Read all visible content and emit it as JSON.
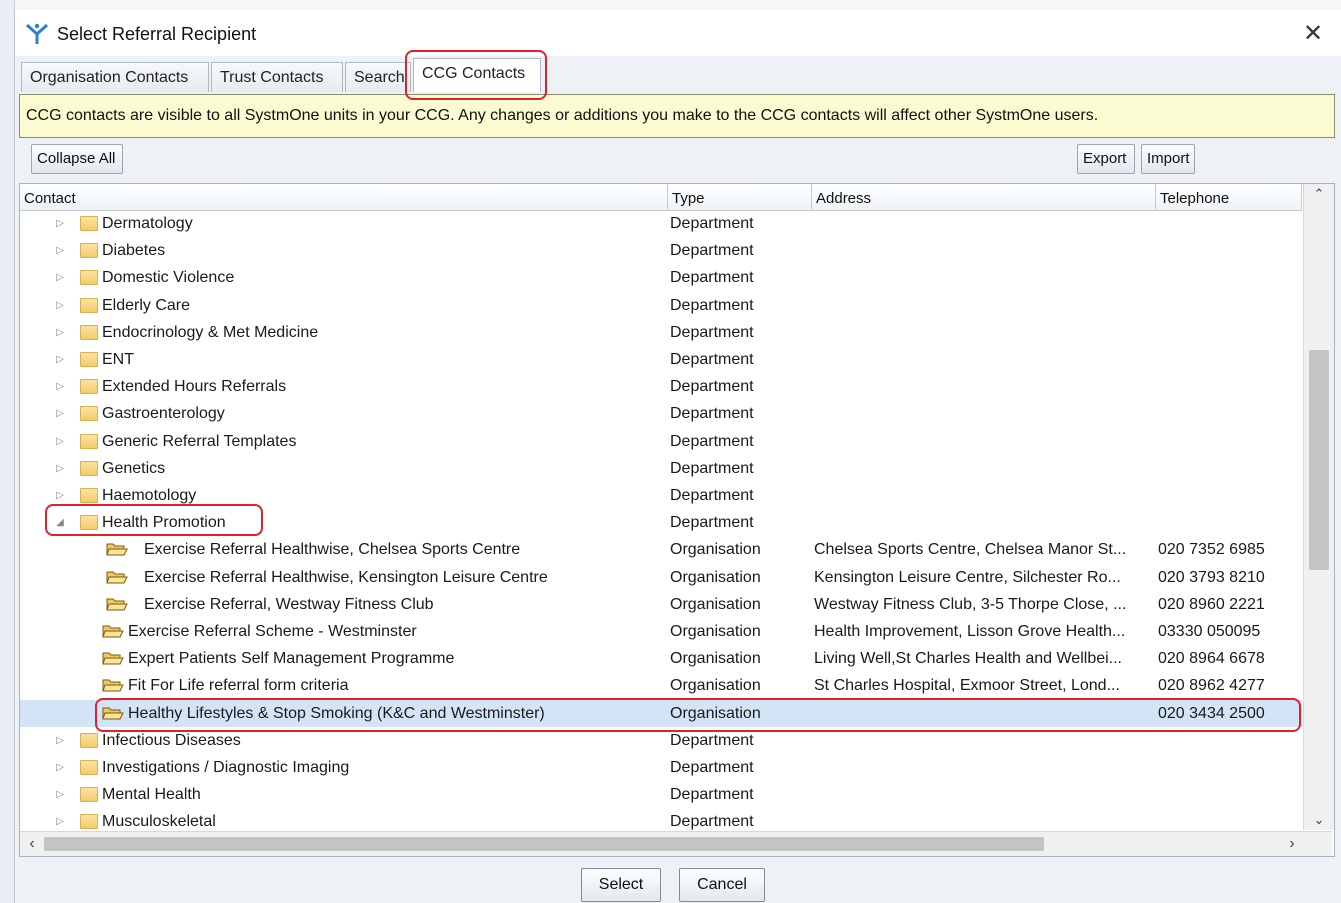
{
  "window": {
    "title": "Select Referral Recipient",
    "close_glyph": "✕"
  },
  "tabs": [
    {
      "label": "Organisation Contacts",
      "active": false
    },
    {
      "label": "Trust Contacts",
      "active": false
    },
    {
      "label": "Search",
      "active": false
    },
    {
      "label": "CCG Contacts",
      "active": true
    }
  ],
  "info_bar": {
    "text": "CCG contacts are visible to all SystmOne units in your CCG. Any changes or additions you make to the CCG contacts will affect other SystmOne users."
  },
  "toolbar": {
    "collapse_label": "Collapse All",
    "export_label": "Export",
    "import_label": "Import"
  },
  "table": {
    "columns": {
      "contact": "Contact",
      "type": "Type",
      "address": "Address",
      "telephone": "Telephone"
    },
    "rows": [
      {
        "contact": "Dermatology",
        "type": "Department",
        "address": "",
        "telephone": "",
        "level": 0,
        "expander": "▷"
      },
      {
        "contact": "Diabetes",
        "type": "Department",
        "address": "",
        "telephone": "",
        "level": 0,
        "expander": "▷"
      },
      {
        "contact": "Domestic Violence",
        "type": "Department",
        "address": "",
        "telephone": "",
        "level": 0,
        "expander": "▷"
      },
      {
        "contact": "Elderly Care",
        "type": "Department",
        "address": "",
        "telephone": "",
        "level": 0,
        "expander": "▷"
      },
      {
        "contact": "Endocrinology & Met Medicine",
        "type": "Department",
        "address": "",
        "telephone": "",
        "level": 0,
        "expander": "▷"
      },
      {
        "contact": "ENT",
        "type": "Department",
        "address": "",
        "telephone": "",
        "level": 0,
        "expander": "▷"
      },
      {
        "contact": "Extended Hours Referrals",
        "type": "Department",
        "address": "",
        "telephone": "",
        "level": 0,
        "expander": "▷"
      },
      {
        "contact": "Gastroenterology",
        "type": "Department",
        "address": "",
        "telephone": "",
        "level": 0,
        "expander": "▷"
      },
      {
        "contact": "Generic Referral Templates",
        "type": "Department",
        "address": "",
        "telephone": "",
        "level": 0,
        "expander": "▷"
      },
      {
        "contact": "Genetics",
        "type": "Department",
        "address": "",
        "telephone": "",
        "level": 0,
        "expander": "▷"
      },
      {
        "contact": "Haemotology",
        "type": "Department",
        "address": "",
        "telephone": "",
        "level": 0,
        "expander": "▷"
      },
      {
        "contact": "Health Promotion",
        "type": "Department",
        "address": "",
        "telephone": "",
        "level": 0,
        "expander": "◢"
      },
      {
        "contact": "Exercise Referral Healthwise, Chelsea Sports Centre",
        "type": "Organisation",
        "address": "Chelsea Sports Centre, Chelsea Manor St...",
        "telephone": "020 7352 6985",
        "level": 1,
        "expander": ""
      },
      {
        "contact": "Exercise Referral Healthwise, Kensington Leisure Centre",
        "type": "Organisation",
        "address": "Kensington Leisure Centre, Silchester Ro...",
        "telephone": "020 3793 8210",
        "level": 1,
        "expander": ""
      },
      {
        "contact": "Exercise Referral, Westway Fitness Club",
        "type": "Organisation",
        "address": "Westway Fitness Club, 3-5 Thorpe Close, ...",
        "telephone": "020 8960 2221",
        "level": 1,
        "expander": ""
      },
      {
        "contact": "Exercise Referral Scheme - Westminster",
        "type": "Organisation",
        "address": "Health Improvement, Lisson Grove Health...",
        "telephone": "03330 050095",
        "level": 1,
        "expander": ""
      },
      {
        "contact": "Expert Patients Self Management Programme",
        "type": "Organisation",
        "address": "Living Well,St Charles Health and Wellbei...",
        "telephone": "020 8964 6678",
        "level": 1,
        "expander": ""
      },
      {
        "contact": "Fit For Life referral form criteria",
        "type": "Organisation",
        "address": "St Charles Hospital, Exmoor Street, Lond...",
        "telephone": "020 8962 4277",
        "level": 1,
        "expander": ""
      },
      {
        "contact": "Healthy Lifestyles & Stop Smoking (K&C and Westminster)",
        "type": "Organisation",
        "address": "",
        "telephone": "020 3434 2500",
        "level": 1,
        "expander": "",
        "selected": true
      },
      {
        "contact": "Infectious Diseases",
        "type": "Department",
        "address": "",
        "telephone": "",
        "level": 0,
        "expander": "▷"
      },
      {
        "contact": "Investigations / Diagnostic Imaging",
        "type": "Department",
        "address": "",
        "telephone": "",
        "level": 0,
        "expander": "▷"
      },
      {
        "contact": "Mental Health",
        "type": "Department",
        "address": "",
        "telephone": "",
        "level": 0,
        "expander": "▷"
      },
      {
        "contact": "Musculoskeletal",
        "type": "Department",
        "address": "",
        "telephone": "",
        "level": 0,
        "expander": "▷"
      }
    ]
  },
  "scroll": {
    "up": "⌃",
    "down": "⌄",
    "left": "‹",
    "right": "›"
  },
  "buttons": {
    "select_label": "Select",
    "cancel_label": "Cancel"
  },
  "colors": {
    "highlight": "#e0212d",
    "selection": "#d4e4f7",
    "info_bg": "#fbfbd2"
  }
}
